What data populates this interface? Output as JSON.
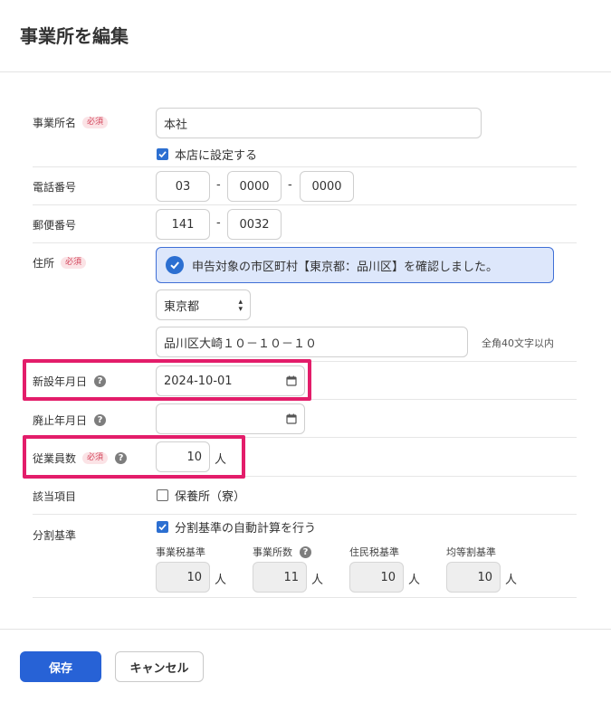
{
  "page_title": "事業所を編集",
  "colors": {
    "primary": "#2762d6",
    "required_text": "#d3455b",
    "required_bg": "#fbe3e6",
    "alert_bg": "#dde7fb",
    "alert_border": "#3f6fd6",
    "highlight": "#e31d6a"
  },
  "office_name": {
    "label": "事業所名",
    "required_badge": "必須",
    "value": "本社",
    "head_office_checkbox": {
      "label": "本店に設定する",
      "checked": true
    }
  },
  "phone": {
    "label": "電話番号",
    "parts": [
      "03",
      "0000",
      "0000"
    ],
    "separator": "-"
  },
  "postal_code": {
    "label": "郵便番号",
    "parts": [
      "141",
      "0032"
    ],
    "separator": "-"
  },
  "address": {
    "label": "住所",
    "required_badge": "必須",
    "alert": "申告対象の市区町村【東京都：品川区】を確認しました。",
    "alert_icon": "check-circle-icon",
    "prefecture": "東京都",
    "street": "品川区大崎１０－１０－１０",
    "note": "全角40文字以内"
  },
  "established_date": {
    "label": "新設年月日",
    "help": "?",
    "value": "2024-10-01",
    "icon": "calendar-icon"
  },
  "closed_date": {
    "label": "廃止年月日",
    "help": "?",
    "value": "",
    "icon": "calendar-icon"
  },
  "employees": {
    "label": "従業員数",
    "required_badge": "必須",
    "help": "?",
    "value": "10",
    "unit": "人"
  },
  "applicable_items": {
    "label": "該当項目",
    "nursery_checkbox": {
      "label": "保養所（寮）",
      "checked": false
    }
  },
  "division_basis": {
    "label": "分割基準",
    "auto_calc_checkbox": {
      "label": "分割基準の自動計算を行う",
      "checked": true
    },
    "fields": [
      {
        "label": "事業税基準",
        "value": "10",
        "unit": "人",
        "help": ""
      },
      {
        "label": "事業所数",
        "value": "11",
        "unit": "人",
        "help": "?"
      },
      {
        "label": "住民税基準",
        "value": "10",
        "unit": "人",
        "help": ""
      },
      {
        "label": "均等割基準",
        "value": "10",
        "unit": "人",
        "help": ""
      }
    ]
  },
  "actions": {
    "save": "保存",
    "cancel": "キャンセル"
  }
}
